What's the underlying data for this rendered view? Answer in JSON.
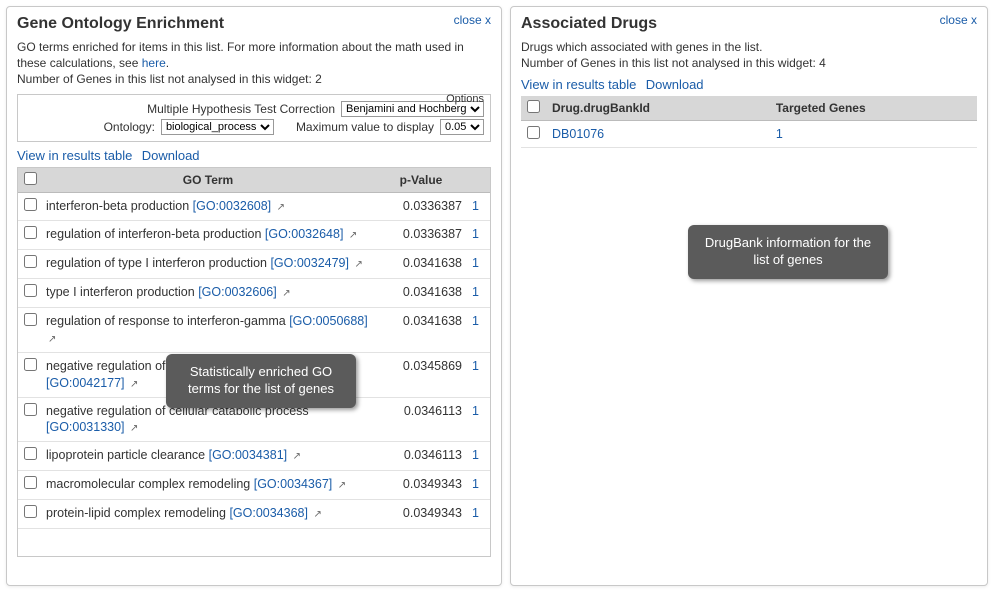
{
  "go_panel": {
    "close": "close x",
    "title": "Gene Ontology Enrichment",
    "desc_part1": "GO terms enriched for items in this list. For more information about the math used in these calculations, see ",
    "desc_link": "here",
    "desc_part2": ".",
    "not_analysed": "Number of Genes in this list not analysed in this widget: 2",
    "options_legend": "Options",
    "mhtc_label": "Multiple Hypothesis Test Correction",
    "mhtc_value": "Benjamini and Hochberg",
    "ontology_label": "Ontology:",
    "ontology_value": "biological_process",
    "maxval_label": "Maximum value to display",
    "maxval_value": "0.05",
    "view_link": "View in results table",
    "download_link": "Download",
    "headers": {
      "term": "GO Term",
      "pvalue": "p-Value"
    },
    "rows": [
      {
        "term": "interferon-beta production",
        "goid": "[GO:0032608]",
        "pvalue": "0.0336387",
        "count": "1"
      },
      {
        "term": "regulation of interferon-beta production",
        "goid": "[GO:0032648]",
        "pvalue": "0.0336387",
        "count": "1"
      },
      {
        "term": "regulation of type I interferon production",
        "goid": "[GO:0032479]",
        "pvalue": "0.0341638",
        "count": "1"
      },
      {
        "term": "type I interferon production",
        "goid": "[GO:0032606]",
        "pvalue": "0.0341638",
        "count": "1"
      },
      {
        "term": "regulation of response to interferon-gamma",
        "goid": "[GO:0050688]",
        "pvalue": "0.0341638",
        "count": "1"
      },
      {
        "term": "negative regulation of protein catabolic process",
        "goid": "[GO:0042177]",
        "pvalue": "0.0345869",
        "count": "1"
      },
      {
        "term": "negative regulation of cellular catabolic process",
        "goid": "[GO:0031330]",
        "pvalue": "0.0346113",
        "count": "1"
      },
      {
        "term": "lipoprotein particle clearance",
        "goid": "[GO:0034381]",
        "pvalue": "0.0346113",
        "count": "1"
      },
      {
        "term": "macromolecular complex remodeling",
        "goid": "[GO:0034367]",
        "pvalue": "0.0349343",
        "count": "1"
      },
      {
        "term": "protein-lipid complex remodeling",
        "goid": "[GO:0034368]",
        "pvalue": "0.0349343",
        "count": "1"
      }
    ]
  },
  "drug_panel": {
    "close": "close x",
    "title": "Associated Drugs",
    "desc": "Drugs which associated with genes in the list.",
    "not_analysed": "Number of Genes in this list not analysed in this widget: 4",
    "view_link": "View in results table",
    "download_link": "Download",
    "headers": {
      "id": "Drug.drugBankId",
      "genes": "Targeted Genes"
    },
    "rows": [
      {
        "id": "DB01076",
        "count": "1"
      }
    ]
  },
  "tooltips": {
    "go": "Statistically enriched GO terms for the list of genes",
    "drug": "DrugBank information for the list of genes"
  }
}
